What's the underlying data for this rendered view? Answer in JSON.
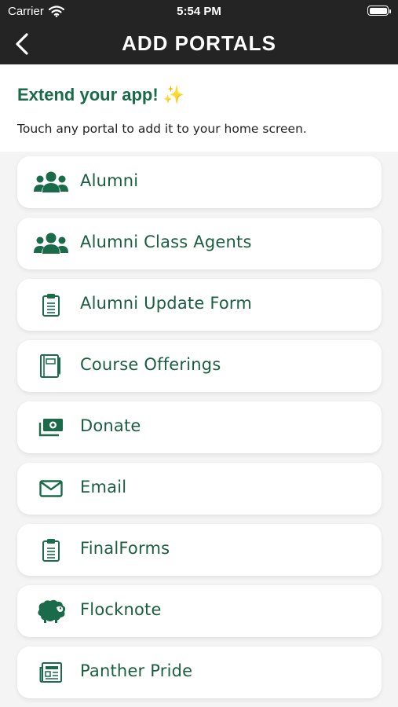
{
  "status_bar": {
    "carrier": "Carrier",
    "time": "5:54 PM"
  },
  "nav": {
    "title": "ADD PORTALS",
    "back_icon": "chevron-left-icon"
  },
  "intro": {
    "headline": "Extend your app!",
    "sparkle": "✨",
    "subtitle": "Touch any portal to add it to your home screen."
  },
  "colors": {
    "brand_green": "#1a6b49",
    "nav_bg": "#242424",
    "list_bg": "#f4f4f4"
  },
  "portals": [
    {
      "label": "Alumni",
      "icon": "users-icon"
    },
    {
      "label": "Alumni Class Agents",
      "icon": "users-icon"
    },
    {
      "label": "Alumni Update Form",
      "icon": "clipboard-icon"
    },
    {
      "label": "Course Offerings",
      "icon": "notebook-icon"
    },
    {
      "label": "Donate",
      "icon": "money-icon"
    },
    {
      "label": "Email",
      "icon": "envelope-icon"
    },
    {
      "label": "FinalForms",
      "icon": "clipboard-icon"
    },
    {
      "label": "Flocknote",
      "icon": "sheep-icon"
    },
    {
      "label": "Panther Pride",
      "icon": "newspaper-icon"
    }
  ]
}
